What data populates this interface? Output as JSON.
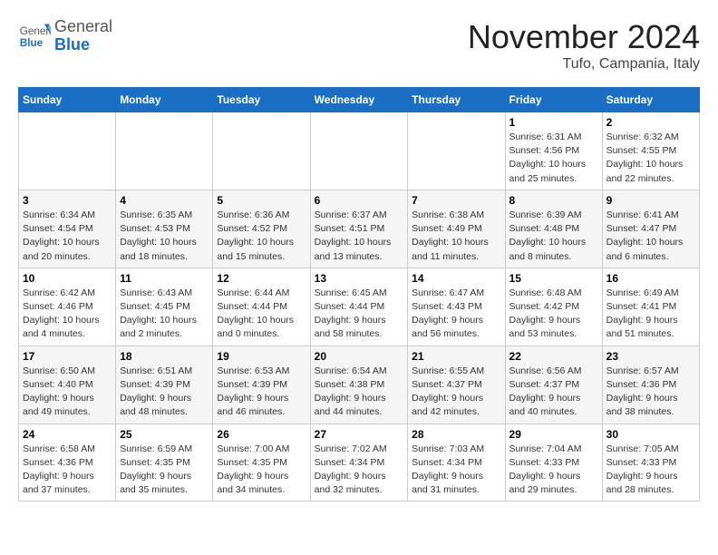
{
  "logo": {
    "general": "General",
    "blue": "Blue"
  },
  "header": {
    "month": "November 2024",
    "location": "Tufo, Campania, Italy"
  },
  "weekdays": [
    "Sunday",
    "Monday",
    "Tuesday",
    "Wednesday",
    "Thursday",
    "Friday",
    "Saturday"
  ],
  "weeks": [
    [
      {
        "day": "",
        "info": ""
      },
      {
        "day": "",
        "info": ""
      },
      {
        "day": "",
        "info": ""
      },
      {
        "day": "",
        "info": ""
      },
      {
        "day": "",
        "info": ""
      },
      {
        "day": "1",
        "info": "Sunrise: 6:31 AM\nSunset: 4:56 PM\nDaylight: 10 hours and 25 minutes."
      },
      {
        "day": "2",
        "info": "Sunrise: 6:32 AM\nSunset: 4:55 PM\nDaylight: 10 hours and 22 minutes."
      }
    ],
    [
      {
        "day": "3",
        "info": "Sunrise: 6:34 AM\nSunset: 4:54 PM\nDaylight: 10 hours and 20 minutes."
      },
      {
        "day": "4",
        "info": "Sunrise: 6:35 AM\nSunset: 4:53 PM\nDaylight: 10 hours and 18 minutes."
      },
      {
        "day": "5",
        "info": "Sunrise: 6:36 AM\nSunset: 4:52 PM\nDaylight: 10 hours and 15 minutes."
      },
      {
        "day": "6",
        "info": "Sunrise: 6:37 AM\nSunset: 4:51 PM\nDaylight: 10 hours and 13 minutes."
      },
      {
        "day": "7",
        "info": "Sunrise: 6:38 AM\nSunset: 4:49 PM\nDaylight: 10 hours and 11 minutes."
      },
      {
        "day": "8",
        "info": "Sunrise: 6:39 AM\nSunset: 4:48 PM\nDaylight: 10 hours and 8 minutes."
      },
      {
        "day": "9",
        "info": "Sunrise: 6:41 AM\nSunset: 4:47 PM\nDaylight: 10 hours and 6 minutes."
      }
    ],
    [
      {
        "day": "10",
        "info": "Sunrise: 6:42 AM\nSunset: 4:46 PM\nDaylight: 10 hours and 4 minutes."
      },
      {
        "day": "11",
        "info": "Sunrise: 6:43 AM\nSunset: 4:45 PM\nDaylight: 10 hours and 2 minutes."
      },
      {
        "day": "12",
        "info": "Sunrise: 6:44 AM\nSunset: 4:44 PM\nDaylight: 10 hours and 0 minutes."
      },
      {
        "day": "13",
        "info": "Sunrise: 6:45 AM\nSunset: 4:44 PM\nDaylight: 9 hours and 58 minutes."
      },
      {
        "day": "14",
        "info": "Sunrise: 6:47 AM\nSunset: 4:43 PM\nDaylight: 9 hours and 56 minutes."
      },
      {
        "day": "15",
        "info": "Sunrise: 6:48 AM\nSunset: 4:42 PM\nDaylight: 9 hours and 53 minutes."
      },
      {
        "day": "16",
        "info": "Sunrise: 6:49 AM\nSunset: 4:41 PM\nDaylight: 9 hours and 51 minutes."
      }
    ],
    [
      {
        "day": "17",
        "info": "Sunrise: 6:50 AM\nSunset: 4:40 PM\nDaylight: 9 hours and 49 minutes."
      },
      {
        "day": "18",
        "info": "Sunrise: 6:51 AM\nSunset: 4:39 PM\nDaylight: 9 hours and 48 minutes."
      },
      {
        "day": "19",
        "info": "Sunrise: 6:53 AM\nSunset: 4:39 PM\nDaylight: 9 hours and 46 minutes."
      },
      {
        "day": "20",
        "info": "Sunrise: 6:54 AM\nSunset: 4:38 PM\nDaylight: 9 hours and 44 minutes."
      },
      {
        "day": "21",
        "info": "Sunrise: 6:55 AM\nSunset: 4:37 PM\nDaylight: 9 hours and 42 minutes."
      },
      {
        "day": "22",
        "info": "Sunrise: 6:56 AM\nSunset: 4:37 PM\nDaylight: 9 hours and 40 minutes."
      },
      {
        "day": "23",
        "info": "Sunrise: 6:57 AM\nSunset: 4:36 PM\nDaylight: 9 hours and 38 minutes."
      }
    ],
    [
      {
        "day": "24",
        "info": "Sunrise: 6:58 AM\nSunset: 4:36 PM\nDaylight: 9 hours and 37 minutes."
      },
      {
        "day": "25",
        "info": "Sunrise: 6:59 AM\nSunset: 4:35 PM\nDaylight: 9 hours and 35 minutes."
      },
      {
        "day": "26",
        "info": "Sunrise: 7:00 AM\nSunset: 4:35 PM\nDaylight: 9 hours and 34 minutes."
      },
      {
        "day": "27",
        "info": "Sunrise: 7:02 AM\nSunset: 4:34 PM\nDaylight: 9 hours and 32 minutes."
      },
      {
        "day": "28",
        "info": "Sunrise: 7:03 AM\nSunset: 4:34 PM\nDaylight: 9 hours and 31 minutes."
      },
      {
        "day": "29",
        "info": "Sunrise: 7:04 AM\nSunset: 4:33 PM\nDaylight: 9 hours and 29 minutes."
      },
      {
        "day": "30",
        "info": "Sunrise: 7:05 AM\nSunset: 4:33 PM\nDaylight: 9 hours and 28 minutes."
      }
    ]
  ]
}
